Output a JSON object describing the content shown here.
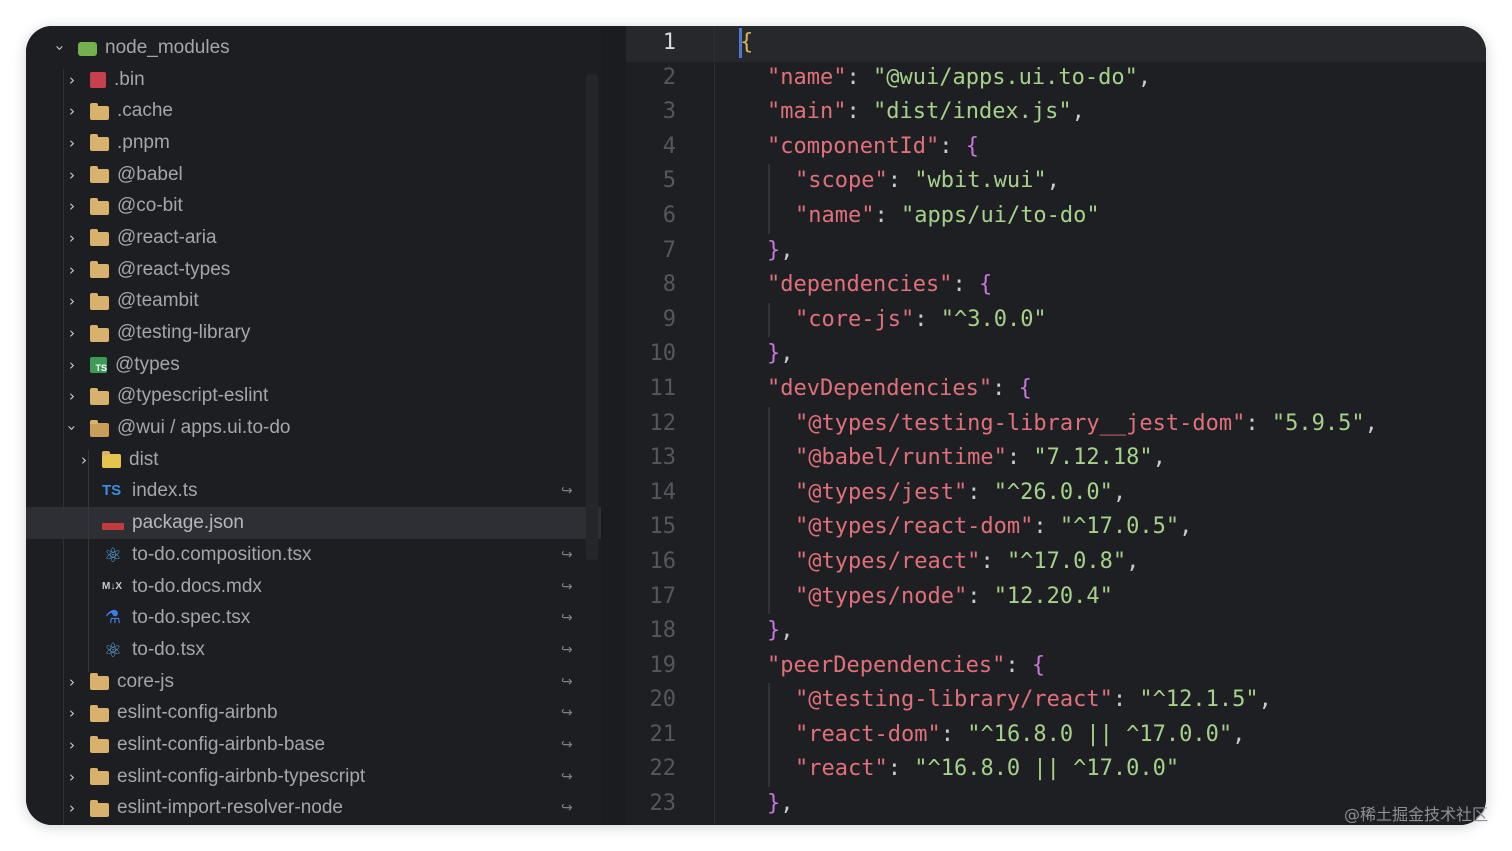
{
  "explorer": {
    "items": [
      {
        "label": "node_modules",
        "icon": "node-modules-folder-icon",
        "chev": "down",
        "level": 0,
        "type": "node"
      },
      {
        "label": ".bin",
        "icon": "bin-folder-icon",
        "chev": "right",
        "level": 1,
        "type": "bin"
      },
      {
        "label": ".cache",
        "icon": "folder-icon",
        "chev": "right",
        "level": 1,
        "type": "folder"
      },
      {
        "label": ".pnpm",
        "icon": "folder-icon",
        "chev": "right",
        "level": 1,
        "type": "folder"
      },
      {
        "label": "@babel",
        "icon": "folder-icon",
        "chev": "right",
        "level": 1,
        "type": "folder"
      },
      {
        "label": "@co-bit",
        "icon": "folder-icon",
        "chev": "right",
        "level": 1,
        "type": "folder"
      },
      {
        "label": "@react-aria",
        "icon": "folder-icon",
        "chev": "right",
        "level": 1,
        "type": "folder"
      },
      {
        "label": "@react-types",
        "icon": "folder-icon",
        "chev": "right",
        "level": 1,
        "type": "folder"
      },
      {
        "label": "@teambit",
        "icon": "folder-icon",
        "chev": "right",
        "level": 1,
        "type": "folder"
      },
      {
        "label": "@testing-library",
        "icon": "folder-icon",
        "chev": "right",
        "level": 1,
        "type": "folder"
      },
      {
        "label": "@types",
        "icon": "typescript-folder-icon",
        "chev": "right",
        "level": 1,
        "type": "types"
      },
      {
        "label": "@typescript-eslint",
        "icon": "folder-icon",
        "chev": "right",
        "level": 1,
        "type": "folder"
      },
      {
        "label": "@wui / apps.ui.to-do",
        "icon": "folder-open-icon",
        "chev": "down",
        "level": 1,
        "type": "open"
      },
      {
        "label": "dist",
        "icon": "dist-folder-icon",
        "chev": "right",
        "level": 2,
        "type": "dist"
      },
      {
        "label": "index.ts",
        "icon": "typescript-file-icon",
        "chev": "",
        "level": 2,
        "type": "ts",
        "mark": "↪"
      },
      {
        "label": "package.json",
        "icon": "npm-file-icon",
        "chev": "",
        "level": 2,
        "type": "npm",
        "selected": true
      },
      {
        "label": "to-do.composition.tsx",
        "icon": "react-file-icon",
        "chev": "",
        "level": 2,
        "type": "react",
        "mark": "↪"
      },
      {
        "label": "to-do.docs.mdx",
        "icon": "mdx-file-icon",
        "chev": "",
        "level": 2,
        "type": "mdx",
        "mark": "↪"
      },
      {
        "label": "to-do.spec.tsx",
        "icon": "test-file-icon",
        "chev": "",
        "level": 2,
        "type": "spec",
        "mark": "↪"
      },
      {
        "label": "to-do.tsx",
        "icon": "react-file-icon",
        "chev": "",
        "level": 2,
        "type": "react",
        "mark": "↪"
      },
      {
        "label": "core-js",
        "icon": "folder-icon",
        "chev": "right",
        "level": 1,
        "type": "folder",
        "mark": "↪"
      },
      {
        "label": "eslint-config-airbnb",
        "icon": "folder-icon",
        "chev": "right",
        "level": 1,
        "type": "folder",
        "mark": "↪"
      },
      {
        "label": "eslint-config-airbnb-base",
        "icon": "folder-icon",
        "chev": "right",
        "level": 1,
        "type": "folder",
        "mark": "↪"
      },
      {
        "label": "eslint-config-airbnb-typescript",
        "icon": "folder-icon",
        "chev": "right",
        "level": 1,
        "type": "folder",
        "mark": "↪"
      },
      {
        "label": "eslint-import-resolver-node",
        "icon": "folder-icon",
        "chev": "right",
        "level": 1,
        "type": "folder",
        "mark": "↪"
      }
    ]
  },
  "editor": {
    "current_line": 1,
    "lines": [
      {
        "n": "1",
        "indent": 0,
        "tokens": [
          {
            "t": "{",
            "c": "b1"
          }
        ]
      },
      {
        "n": "2",
        "indent": 1,
        "tokens": [
          {
            "t": "\"name\"",
            "c": "k"
          },
          {
            "t": ": ",
            "c": "p"
          },
          {
            "t": "\"@wui/apps.ui.to-do\"",
            "c": "s"
          },
          {
            "t": ",",
            "c": "p"
          }
        ]
      },
      {
        "n": "3",
        "indent": 1,
        "tokens": [
          {
            "t": "\"main\"",
            "c": "k"
          },
          {
            "t": ": ",
            "c": "p"
          },
          {
            "t": "\"dist/index.js\"",
            "c": "s"
          },
          {
            "t": ",",
            "c": "p"
          }
        ]
      },
      {
        "n": "4",
        "indent": 1,
        "tokens": [
          {
            "t": "\"componentId\"",
            "c": "k"
          },
          {
            "t": ": ",
            "c": "p"
          },
          {
            "t": "{",
            "c": "b"
          }
        ]
      },
      {
        "n": "5",
        "indent": 2,
        "tokens": [
          {
            "t": "\"scope\"",
            "c": "k"
          },
          {
            "t": ": ",
            "c": "p"
          },
          {
            "t": "\"wbit.wui\"",
            "c": "s"
          },
          {
            "t": ",",
            "c": "p"
          }
        ]
      },
      {
        "n": "6",
        "indent": 2,
        "tokens": [
          {
            "t": "\"name\"",
            "c": "k"
          },
          {
            "t": ": ",
            "c": "p"
          },
          {
            "t": "\"apps/ui/to-do\"",
            "c": "s"
          }
        ]
      },
      {
        "n": "7",
        "indent": 1,
        "tokens": [
          {
            "t": "}",
            "c": "b"
          },
          {
            "t": ",",
            "c": "p"
          }
        ]
      },
      {
        "n": "8",
        "indent": 1,
        "tokens": [
          {
            "t": "\"dependencies\"",
            "c": "k"
          },
          {
            "t": ": ",
            "c": "p"
          },
          {
            "t": "{",
            "c": "b"
          }
        ]
      },
      {
        "n": "9",
        "indent": 2,
        "tokens": [
          {
            "t": "\"core-js\"",
            "c": "k"
          },
          {
            "t": ": ",
            "c": "p"
          },
          {
            "t": "\"^3.0.0\"",
            "c": "s"
          }
        ]
      },
      {
        "n": "10",
        "indent": 1,
        "tokens": [
          {
            "t": "}",
            "c": "b"
          },
          {
            "t": ",",
            "c": "p"
          }
        ]
      },
      {
        "n": "11",
        "indent": 1,
        "tokens": [
          {
            "t": "\"devDependencies\"",
            "c": "k"
          },
          {
            "t": ": ",
            "c": "p"
          },
          {
            "t": "{",
            "c": "b"
          }
        ]
      },
      {
        "n": "12",
        "indent": 2,
        "tokens": [
          {
            "t": "\"@types/testing-library__jest-dom\"",
            "c": "k"
          },
          {
            "t": ": ",
            "c": "p"
          },
          {
            "t": "\"5.9.5\"",
            "c": "s"
          },
          {
            "t": ",",
            "c": "p"
          }
        ]
      },
      {
        "n": "13",
        "indent": 2,
        "tokens": [
          {
            "t": "\"@babel/runtime\"",
            "c": "k"
          },
          {
            "t": ": ",
            "c": "p"
          },
          {
            "t": "\"7.12.18\"",
            "c": "s"
          },
          {
            "t": ",",
            "c": "p"
          }
        ]
      },
      {
        "n": "14",
        "indent": 2,
        "tokens": [
          {
            "t": "\"@types/jest\"",
            "c": "k"
          },
          {
            "t": ": ",
            "c": "p"
          },
          {
            "t": "\"^26.0.0\"",
            "c": "s"
          },
          {
            "t": ",",
            "c": "p"
          }
        ]
      },
      {
        "n": "15",
        "indent": 2,
        "tokens": [
          {
            "t": "\"@types/react-dom\"",
            "c": "k"
          },
          {
            "t": ": ",
            "c": "p"
          },
          {
            "t": "\"^17.0.5\"",
            "c": "s"
          },
          {
            "t": ",",
            "c": "p"
          }
        ]
      },
      {
        "n": "16",
        "indent": 2,
        "tokens": [
          {
            "t": "\"@types/react\"",
            "c": "k"
          },
          {
            "t": ": ",
            "c": "p"
          },
          {
            "t": "\"^17.0.8\"",
            "c": "s"
          },
          {
            "t": ",",
            "c": "p"
          }
        ]
      },
      {
        "n": "17",
        "indent": 2,
        "tokens": [
          {
            "t": "\"@types/node\"",
            "c": "k"
          },
          {
            "t": ": ",
            "c": "p"
          },
          {
            "t": "\"12.20.4\"",
            "c": "s"
          }
        ]
      },
      {
        "n": "18",
        "indent": 1,
        "tokens": [
          {
            "t": "}",
            "c": "b"
          },
          {
            "t": ",",
            "c": "p"
          }
        ]
      },
      {
        "n": "19",
        "indent": 1,
        "tokens": [
          {
            "t": "\"peerDependencies\"",
            "c": "k"
          },
          {
            "t": ": ",
            "c": "p"
          },
          {
            "t": "{",
            "c": "b"
          }
        ]
      },
      {
        "n": "20",
        "indent": 2,
        "tokens": [
          {
            "t": "\"@testing-library/react\"",
            "c": "k"
          },
          {
            "t": ": ",
            "c": "p"
          },
          {
            "t": "\"^12.1.5\"",
            "c": "s"
          },
          {
            "t": ",",
            "c": "p"
          }
        ]
      },
      {
        "n": "21",
        "indent": 2,
        "tokens": [
          {
            "t": "\"react-dom\"",
            "c": "k"
          },
          {
            "t": ": ",
            "c": "p"
          },
          {
            "t": "\"^16.8.0 || ^17.0.0\"",
            "c": "s"
          },
          {
            "t": ",",
            "c": "p"
          }
        ]
      },
      {
        "n": "22",
        "indent": 2,
        "tokens": [
          {
            "t": "\"react\"",
            "c": "k"
          },
          {
            "t": ": ",
            "c": "p"
          },
          {
            "t": "\"^16.8.0 || ^17.0.0\"",
            "c": "s"
          }
        ]
      },
      {
        "n": "23",
        "indent": 1,
        "tokens": [
          {
            "t": "}",
            "c": "b"
          },
          {
            "t": ",",
            "c": "p"
          }
        ]
      }
    ]
  },
  "watermark": "@稀土掘金技术社区",
  "colors": {
    "window_bg": "#1e1f22",
    "key": "#e0707b",
    "string": "#a6d18b",
    "bracket": "#c678dd",
    "outer_brace": "#d9b45c",
    "cursor": "#4d78cc"
  }
}
